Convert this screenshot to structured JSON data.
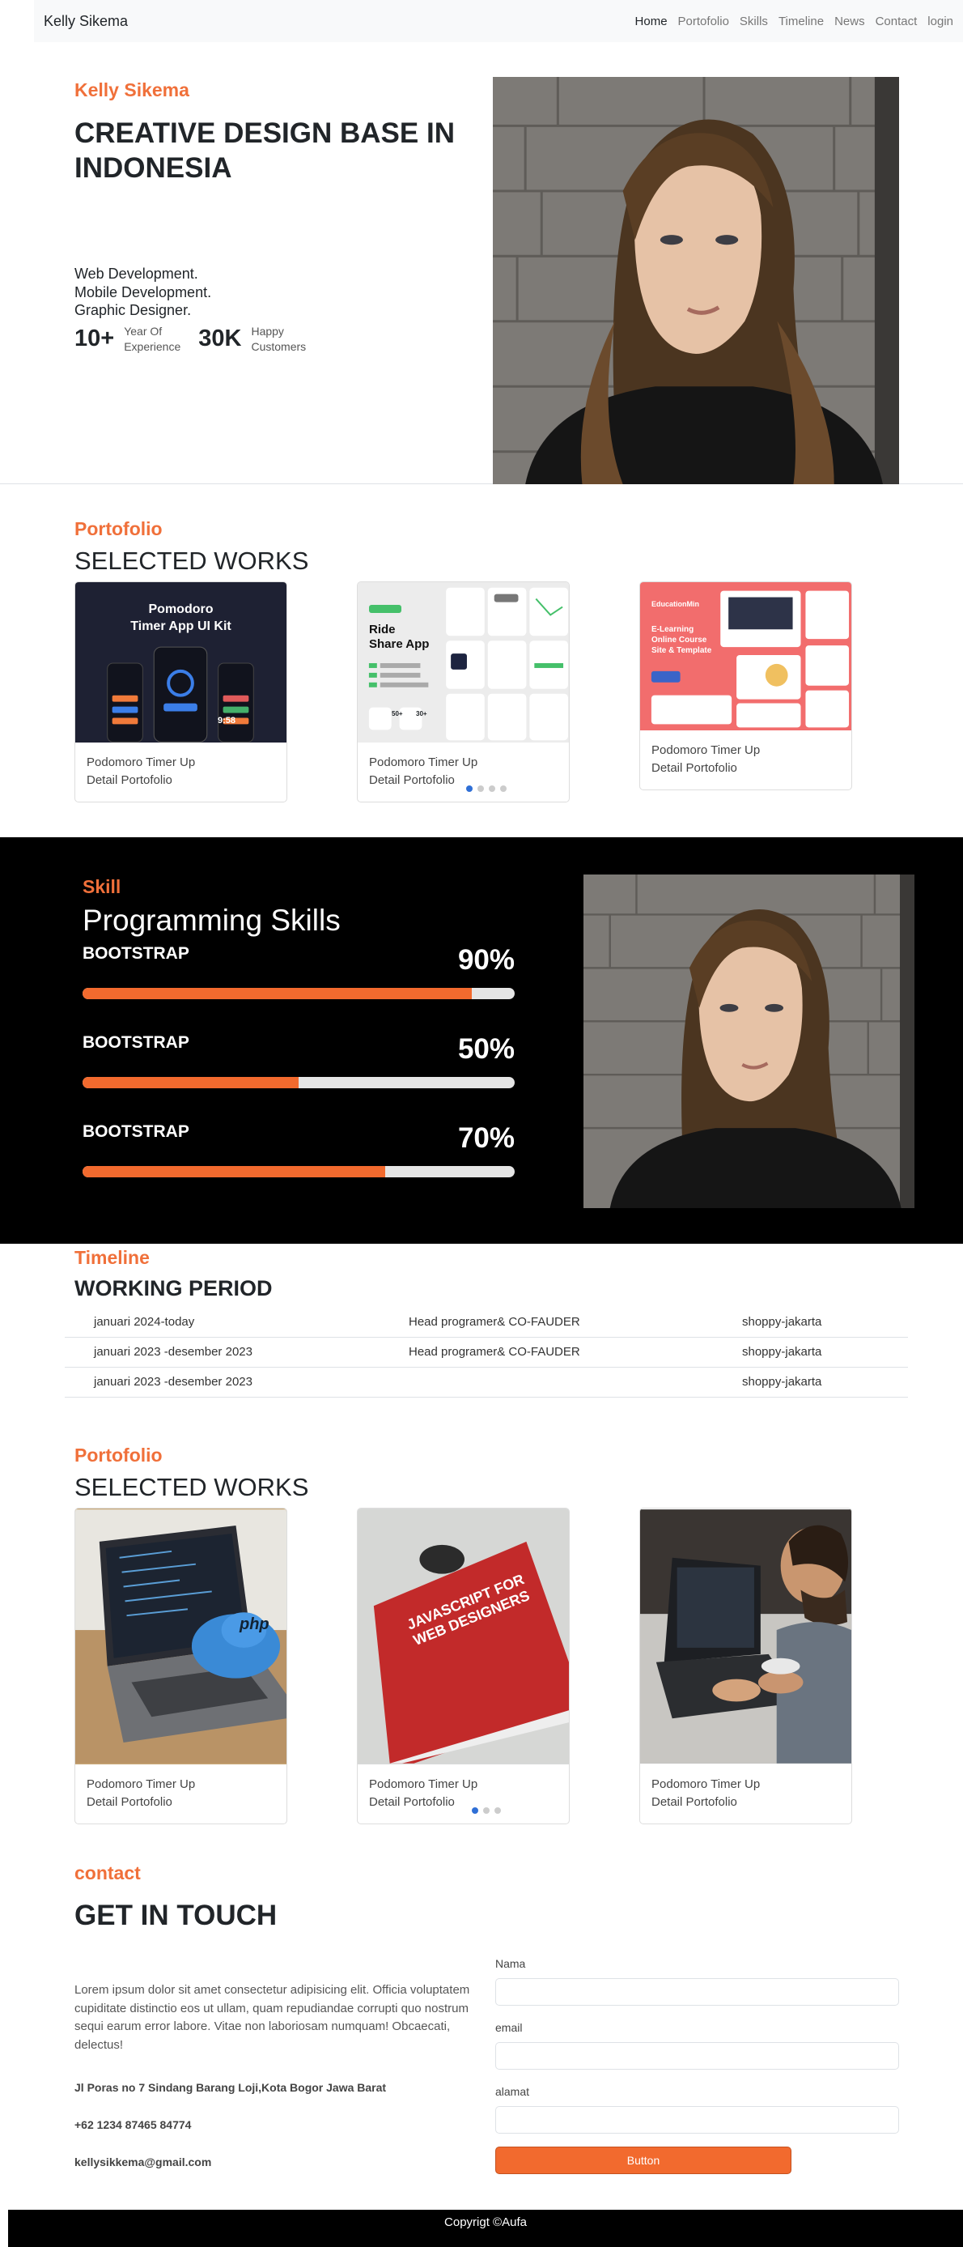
{
  "nav": {
    "brand": "Kelly Sikema",
    "links": [
      "Home",
      "Portofolio",
      "Skills",
      "Timeline",
      "News",
      "Contact",
      "login"
    ]
  },
  "hero": {
    "name": "Kelly Sikema",
    "title": "CREATIVE DESIGN BASE IN INDONESIA",
    "desc": [
      "Web Development.",
      "Mobile Development.",
      "Graphic Designer."
    ],
    "stats": [
      {
        "num": "10+",
        "label1": "Year Of",
        "label2": "Experience"
      },
      {
        "num": "30K",
        "label1": "Happy",
        "label2": "Customers"
      }
    ]
  },
  "portfolio1": {
    "label": "Portofolio",
    "title": "SELECTED WORKS",
    "cards": [
      {
        "line1": "Podomoro Timer Up",
        "line2": "Detail Portofolio",
        "image_text1": "Pomodoro",
        "image_text2": "Timer App UI Kit",
        "clock": "9:58"
      },
      {
        "line1": "Podomoro Timer Up",
        "line2": "Detail Portofolio",
        "image_text1": "Ride",
        "image_text2": "Share App",
        "stat1": "50+",
        "stat2": "30+"
      },
      {
        "line1": "Podomoro Timer Up",
        "line2": "Detail Portofolio",
        "image_text1": "E-Learning",
        "image_text2": "Online Course",
        "image_text3": "Site & Template",
        "brand": "EducationMin"
      }
    ]
  },
  "skills": {
    "label": "Skill",
    "title": "Programming Skills",
    "items": [
      {
        "name": "BOOTSTRAP",
        "percent": "90%",
        "level": 0.9
      },
      {
        "name": "BOOTSTRAP",
        "percent": "50%",
        "level": 0.5
      },
      {
        "name": "BOOTSTRAP",
        "percent": "70%",
        "level": 0.7
      }
    ]
  },
  "timeline": {
    "label": "Timeline",
    "title": "WORKING PERIOD",
    "rows": [
      [
        "januari 2024-today",
        "Head programer& CO-FAUDER",
        "shoppy-jakarta"
      ],
      [
        "januari 2023 -desember 2023",
        "Head programer& CO-FAUDER",
        "shoppy-jakarta"
      ],
      [
        "januari 2023 -desember 2023",
        "",
        "shoppy-jakarta"
      ]
    ]
  },
  "portfolio2": {
    "label": "Portofolio",
    "title": "SELECTED WORKS",
    "cards": [
      {
        "line1": "Podomoro Timer Up",
        "line2": "Detail Portofolio",
        "image_text1": "php"
      },
      {
        "line1": "Podomoro Timer Up",
        "line2": "Detail Portofolio",
        "image_text1": "JAVASCRIPT FOR",
        "image_text2": "WEB DESIGNERS"
      },
      {
        "line1": "Podomoro Timer Up",
        "line2": "Detail Portofolio"
      }
    ]
  },
  "contact": {
    "label": "contact",
    "title": "GET IN TOUCH",
    "paragraph": "Lorem ipsum dolor sit amet consectetur adipisicing elit. Officia voluptatem cupiditate distinctio eos ut ullam, quam repudiandae corrupti quo nostrum sequi earum error labore. Vitae non laboriosam numquam! Obcaecati, delectus!",
    "address": "Jl Poras no 7 Sindang Barang Loji,Kota Bogor Jawa Barat",
    "phone": "+62 1234 87465 84774",
    "email": "kellysikkema@gmail.com",
    "form": {
      "name_label": "Nama",
      "email_label": "email",
      "address_label": "alamat",
      "button": "Button"
    }
  },
  "footer": {
    "text": "Copyrigt ©Aufa"
  },
  "colors": {
    "accent": "#f0703a",
    "bar": "#f26a2e",
    "dark": "#000000",
    "nav_bg": "#f8f9fa"
  }
}
